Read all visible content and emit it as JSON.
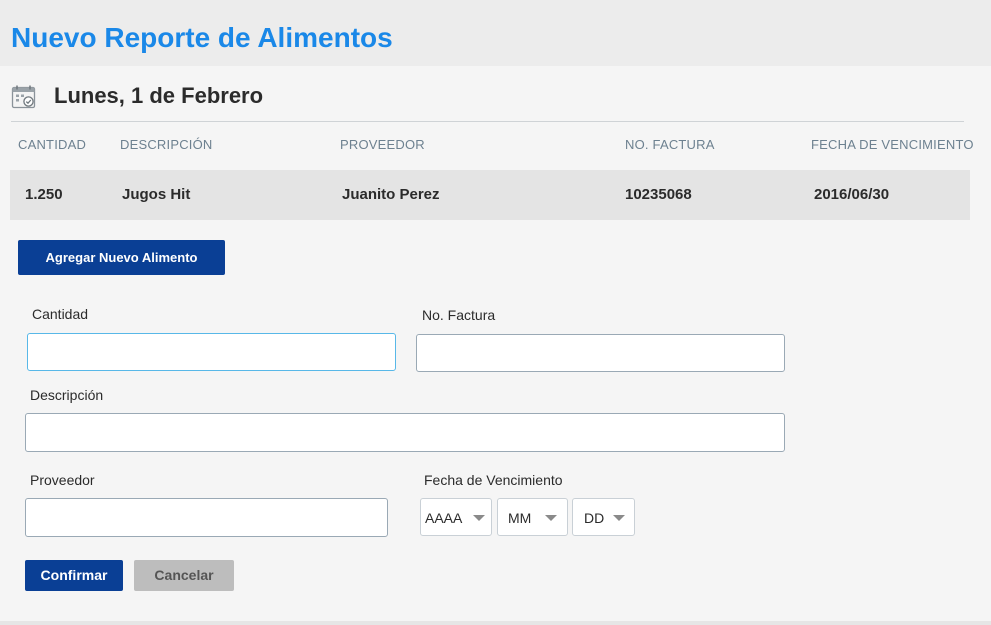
{
  "header": {
    "title": "Nuevo Reporte de Alimentos"
  },
  "date_section": {
    "title": "Lunes, 1 de Febrero",
    "icon": "calendar-check-icon"
  },
  "table": {
    "headers": {
      "quantity": "CANTIDAD",
      "description": "DESCRIPCIÓN",
      "supplier": "PROVEEDOR",
      "invoice": "NO. FACTURA",
      "expiry": "FECHA DE VENCIMIENTO"
    },
    "rows": [
      {
        "quantity": "1.250",
        "description": "Jugos Hit",
        "supplier": "Juanito Perez",
        "invoice": "10235068",
        "expiry": "2016/06/30"
      }
    ]
  },
  "actions": {
    "add_label": "Agregar Nuevo Alimento"
  },
  "form": {
    "quantity": {
      "label": "Cantidad",
      "value": "",
      "placeholder": ""
    },
    "invoice": {
      "label": "No. Factura",
      "value": "",
      "placeholder": ""
    },
    "description": {
      "label": "Descripción",
      "value": "",
      "placeholder": ""
    },
    "supplier": {
      "label": "Proveedor",
      "value": "",
      "placeholder": ""
    },
    "expiry": {
      "label": "Fecha de Vencimiento",
      "year": "AAAA",
      "month": "MM",
      "day": "DD"
    },
    "confirm_label": "Confirmar",
    "cancel_label": "Cancelar"
  },
  "colors": {
    "title": "#1a88e8",
    "primary_button": "#0a3f95",
    "cancel_button": "#bdbdbd",
    "row_background": "#e4e4e4",
    "focus_border": "#58b8e8"
  }
}
